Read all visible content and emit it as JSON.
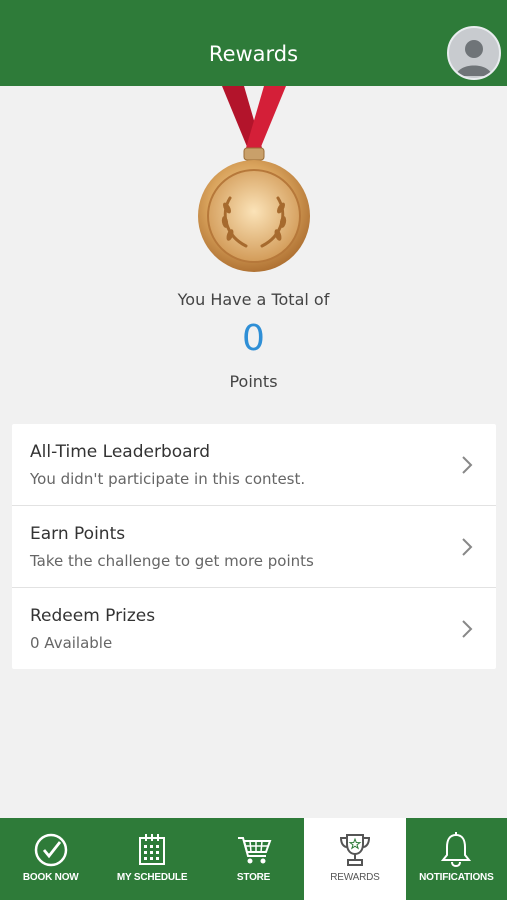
{
  "header": {
    "title": "Rewards"
  },
  "summary": {
    "total_text": "You Have a Total of",
    "points": "0",
    "points_label": "Points"
  },
  "menu": [
    {
      "title": "All-Time Leaderboard",
      "subtitle": "You didn't participate in this contest."
    },
    {
      "title": "Earn Points",
      "subtitle": "Take the challenge to get more points"
    },
    {
      "title": "Redeem Prizes",
      "subtitle": "0 Available"
    }
  ],
  "tabs": [
    {
      "label": "BOOK NOW",
      "icon": "check-circle-icon"
    },
    {
      "label": "MY SCHEDULE",
      "icon": "calendar-icon"
    },
    {
      "label": "STORE",
      "icon": "cart-icon"
    },
    {
      "label": "REWARDS",
      "icon": "trophy-icon",
      "active": true
    },
    {
      "label": "NOTIFICATIONS",
      "icon": "bell-icon"
    }
  ],
  "colors": {
    "brand_green": "#2e7b39",
    "points_blue": "#2f8fd6",
    "ribbon_red": "#c2182f",
    "medal_gold": "#d49a52"
  }
}
